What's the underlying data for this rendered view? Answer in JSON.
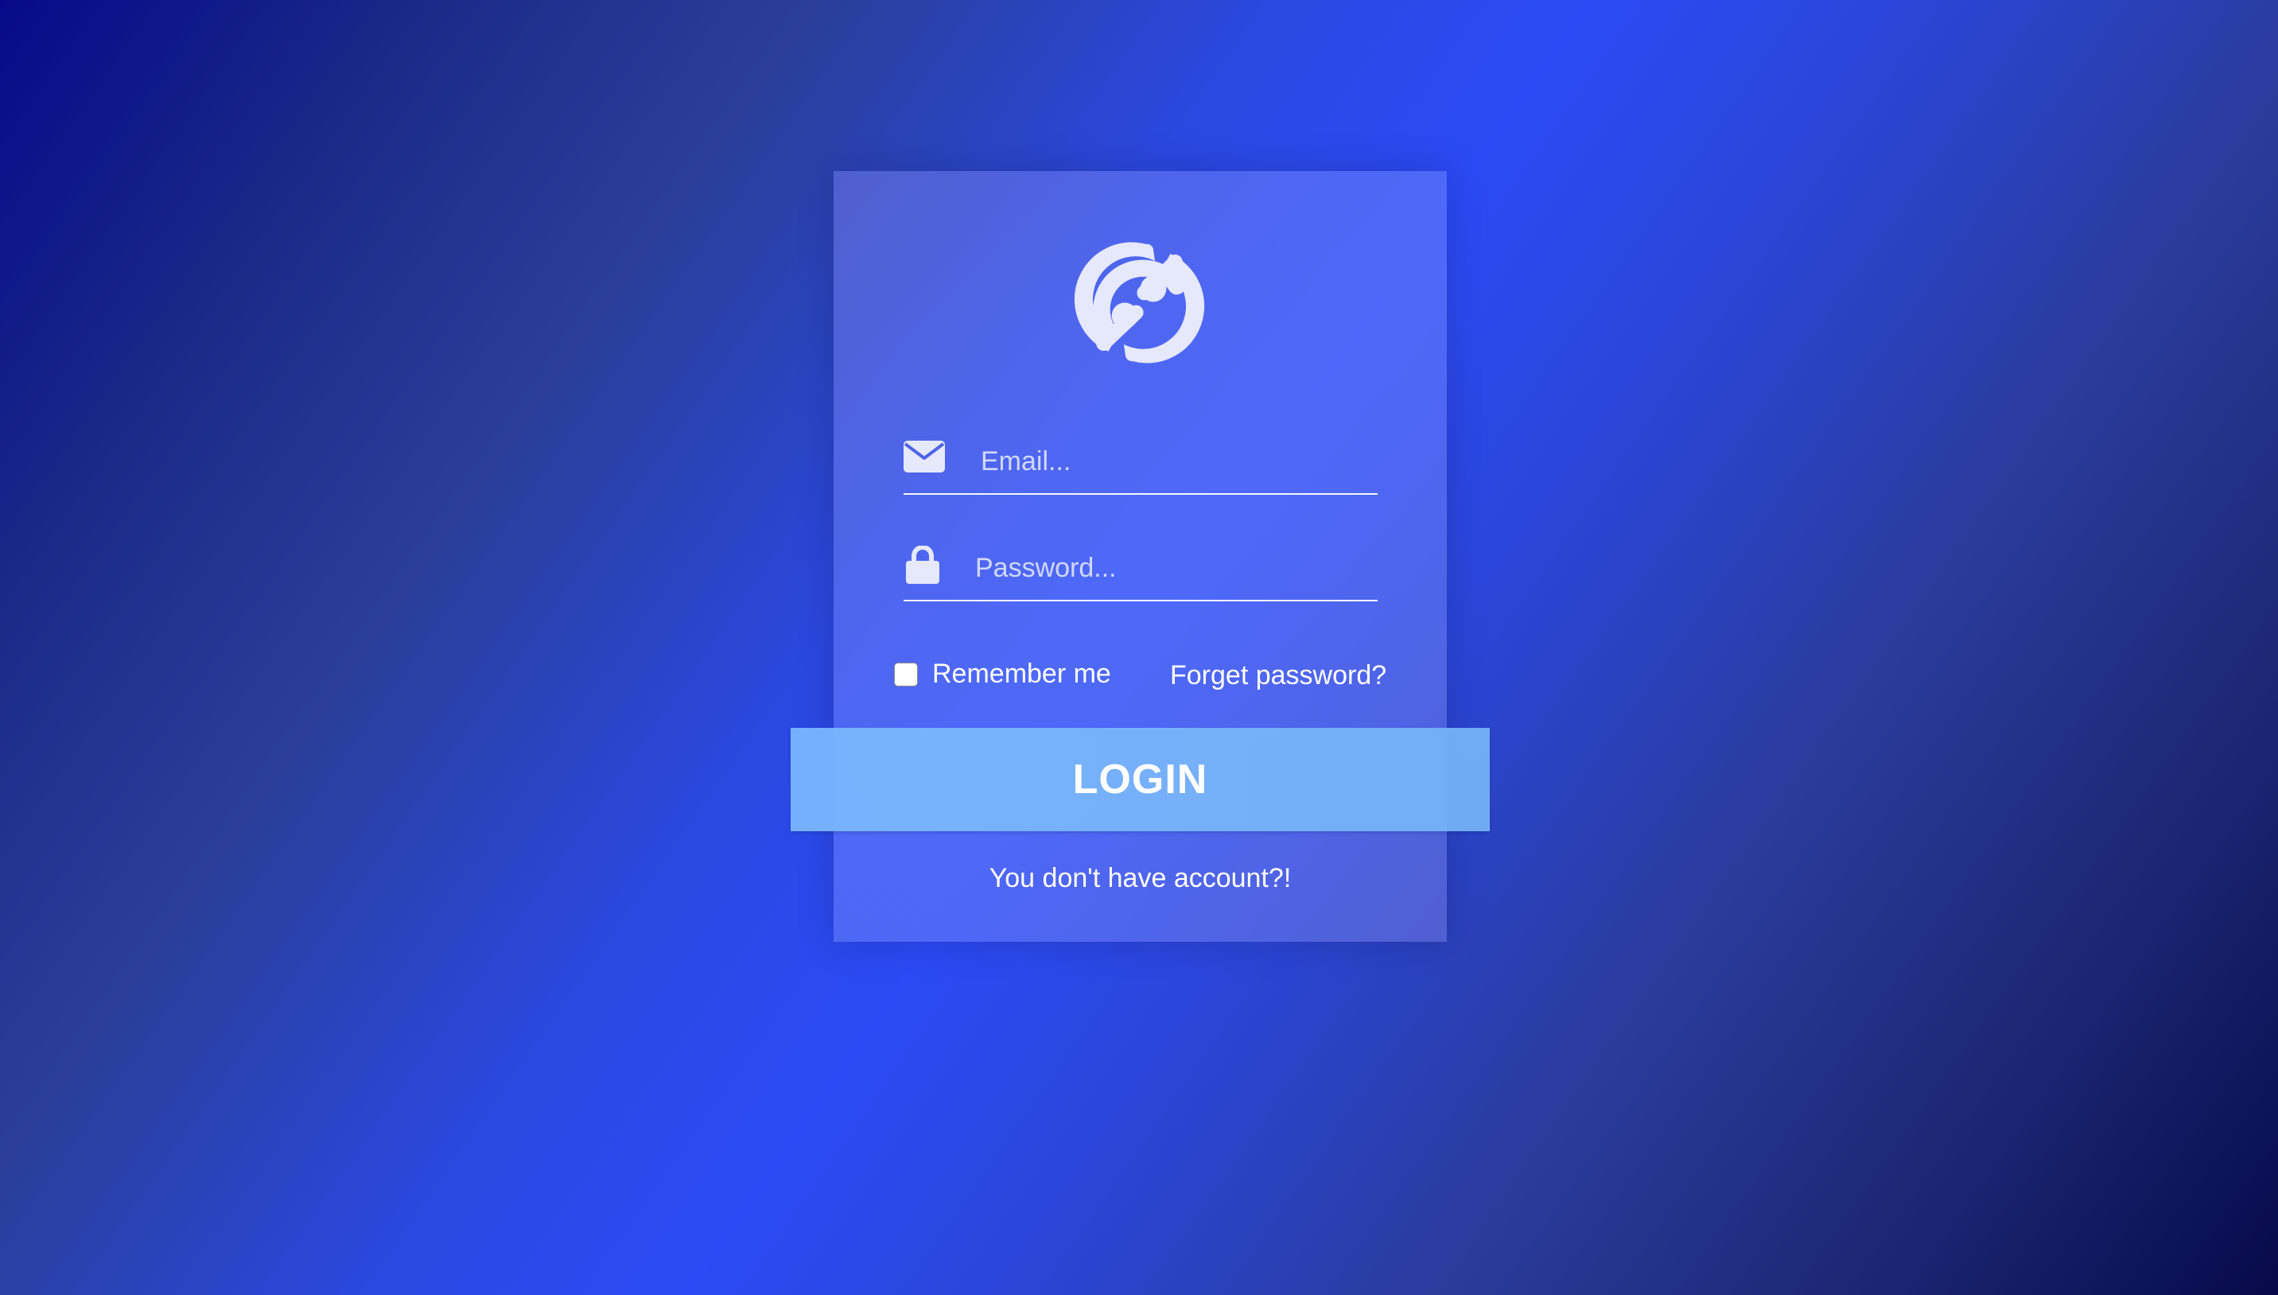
{
  "login_form": {
    "logo_icon": "sync-arrows-icon",
    "email": {
      "icon": "envelope-icon",
      "placeholder": "Email...",
      "value": ""
    },
    "password": {
      "icon": "lock-icon",
      "placeholder": "Password...",
      "value": ""
    },
    "remember_me": {
      "label": "Remember me",
      "checked": false
    },
    "forget_password_label": "Forget password?",
    "login_button_label": "LOGIN",
    "signup_prompt": "You don't have account?!"
  },
  "colors": {
    "icon_fill": "#e6e8fb",
    "button": "#7bb8ff",
    "background_dark": "#060a8a",
    "background_bright": "#2c4af5"
  }
}
